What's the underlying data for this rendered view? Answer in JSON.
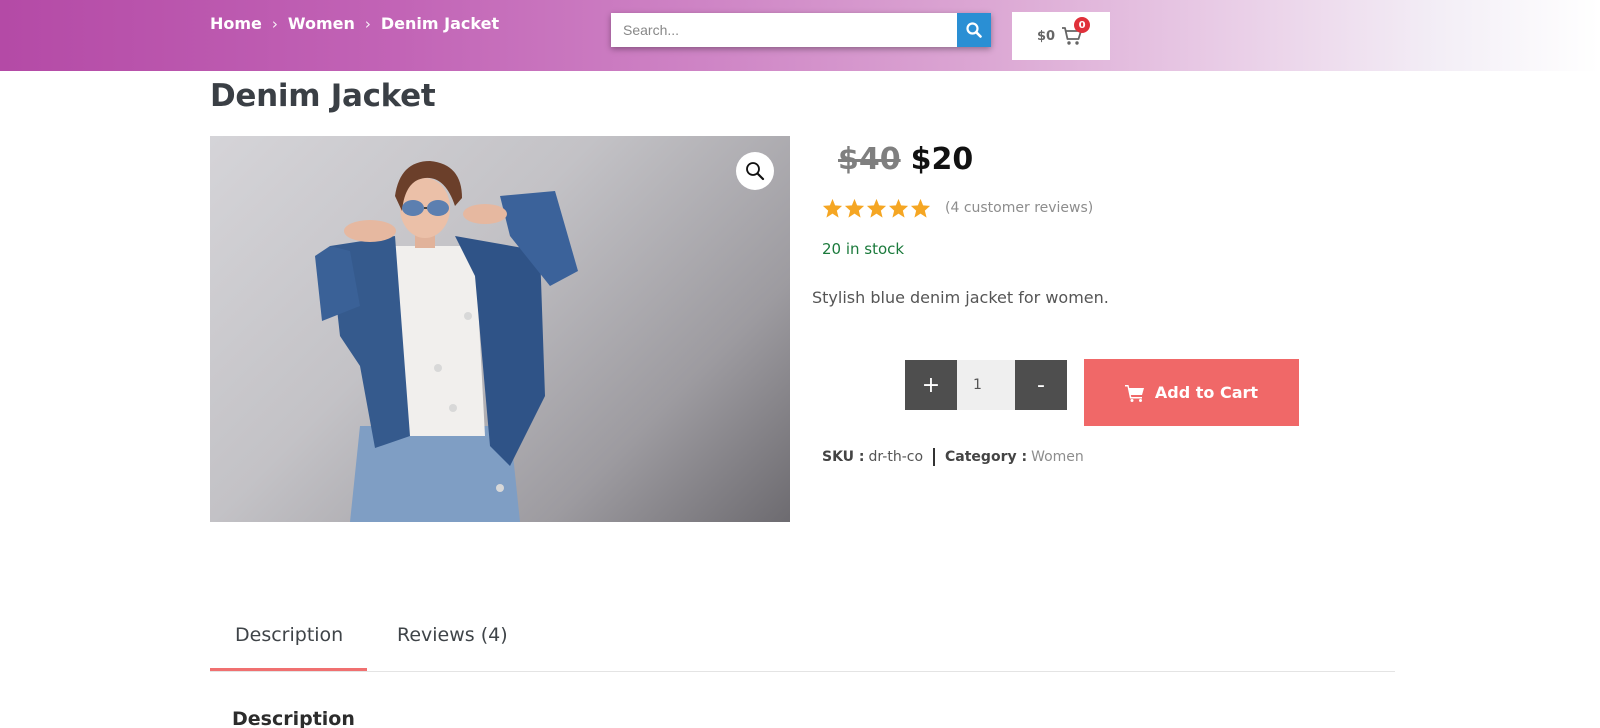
{
  "header": {
    "breadcrumb": [
      "Home",
      "Women",
      "Denim Jacket"
    ],
    "separator": "›",
    "search_placeholder": "Search...",
    "cart_total": "$0",
    "cart_count": "0"
  },
  "product": {
    "title": "Denim Jacket",
    "price_old": "$40",
    "price_new": "$20",
    "rating_stars": 5,
    "rating_max": 5,
    "review_text": "(4 customer reviews)",
    "stock_text": "20 in stock",
    "short_description": "Stylish blue denim jacket for women.",
    "quantity": "1",
    "plus_label": "+",
    "minus_label": "-",
    "add_to_cart_label": "Add to Cart",
    "sku_label": "SKU :",
    "sku_value": "dr-th-co",
    "category_label": "Category :",
    "category_value": "Women"
  },
  "tabs": [
    {
      "label": "Description",
      "active": true
    },
    {
      "label": "Reviews (4)",
      "active": false
    }
  ],
  "description_heading": "Description",
  "colors": {
    "accent": "#f06868",
    "search_button": "#2a8fd4",
    "stock": "#1b7a3c",
    "star": "#f5a623"
  },
  "icons": {
    "search": "search-icon",
    "cart": "cart-icon",
    "zoom": "zoom-icon",
    "star": "star-icon"
  }
}
